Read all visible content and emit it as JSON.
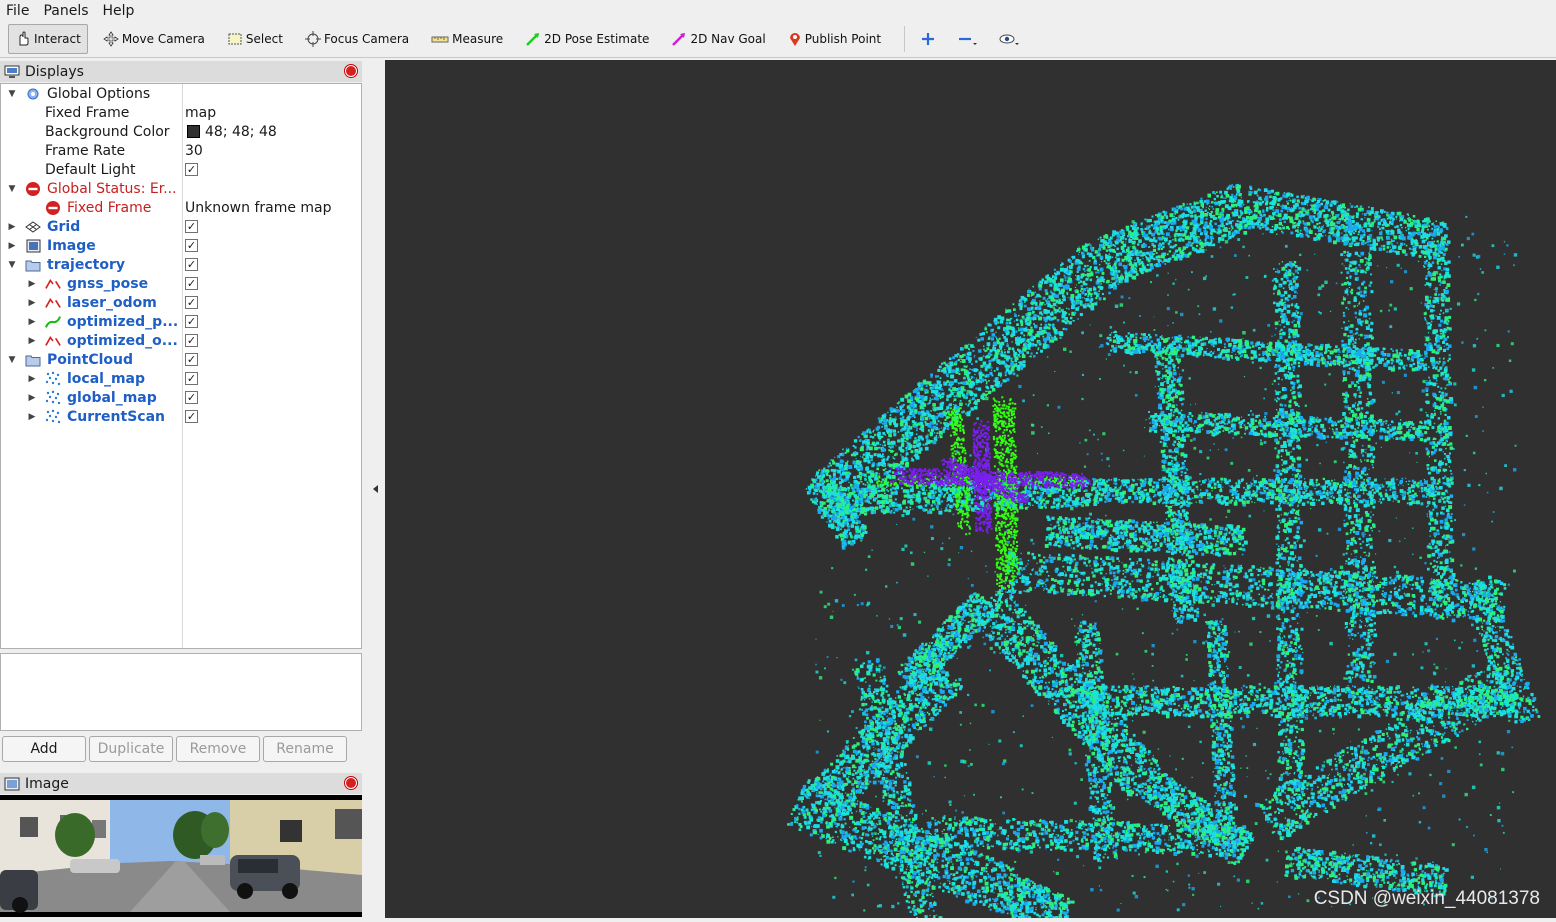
{
  "menu": [
    "File",
    "Panels",
    "Help"
  ],
  "toolbar": [
    {
      "label": "Interact",
      "icon": "interact-icon",
      "active": true
    },
    {
      "label": "Move Camera",
      "icon": "move-camera-icon"
    },
    {
      "label": "Select",
      "icon": "select-icon"
    },
    {
      "label": "Focus Camera",
      "icon": "focus-camera-icon"
    },
    {
      "label": "Measure",
      "icon": "measure-icon"
    },
    {
      "label": "2D Pose Estimate",
      "icon": "pose-estimate-icon",
      "color": "#22cc22"
    },
    {
      "label": "2D Nav Goal",
      "icon": "nav-goal-icon",
      "color": "#cc22cc"
    },
    {
      "label": "Publish Point",
      "icon": "publish-point-icon",
      "color": "#d83a1a"
    }
  ],
  "displays_panel": {
    "title": "Displays",
    "rows": [
      {
        "label": "Global Options",
        "value": "",
        "style": "normal",
        "depth": 0,
        "arrow": "down",
        "icon": "gear-icon"
      },
      {
        "label": "Fixed Frame",
        "value": "map",
        "style": "normal",
        "depth": 1
      },
      {
        "label": "Background Color",
        "value": "48; 48; 48",
        "style": "normal",
        "depth": 1,
        "swatch": "#303030"
      },
      {
        "label": "Frame Rate",
        "value": "30",
        "style": "normal",
        "depth": 1
      },
      {
        "label": "Default Light",
        "value": "",
        "style": "normal",
        "depth": 1,
        "checked": true
      },
      {
        "label": "Global Status: Er...",
        "value": "",
        "style": "red",
        "depth": 0,
        "arrow": "down",
        "icon": "error-icon"
      },
      {
        "label": "Fixed Frame",
        "value": "Unknown frame map",
        "style": "red",
        "depth": 1,
        "icon": "error-icon"
      },
      {
        "label": "Grid",
        "value": "",
        "style": "blue",
        "depth": 0,
        "arrow": "right",
        "icon": "grid-icon",
        "checked": true
      },
      {
        "label": "Image",
        "value": "",
        "style": "blue",
        "depth": 0,
        "arrow": "right",
        "icon": "image-icon",
        "checked": true
      },
      {
        "label": "trajectory",
        "value": "",
        "style": "blue",
        "depth": 0,
        "arrow": "down",
        "icon": "folder-icon",
        "checked": true
      },
      {
        "label": "gnss_pose",
        "value": "",
        "style": "blue",
        "depth": 1,
        "arrow": "right",
        "icon": "path-red-icon",
        "checked": true
      },
      {
        "label": "laser_odom",
        "value": "",
        "style": "blue",
        "depth": 1,
        "arrow": "right",
        "icon": "path-red-icon",
        "checked": true
      },
      {
        "label": "optimized_p...",
        "value": "",
        "style": "blue",
        "depth": 1,
        "arrow": "right",
        "icon": "path-green-icon",
        "checked": true
      },
      {
        "label": "optimized_o...",
        "value": "",
        "style": "blue",
        "depth": 1,
        "arrow": "right",
        "icon": "path-red-icon",
        "checked": true
      },
      {
        "label": "PointCloud",
        "value": "",
        "style": "blue",
        "depth": 0,
        "arrow": "down",
        "icon": "folder-icon",
        "checked": true
      },
      {
        "label": "local_map",
        "value": "",
        "style": "blue",
        "depth": 1,
        "arrow": "right",
        "icon": "pointcloud-icon",
        "checked": true
      },
      {
        "label": "global_map",
        "value": "",
        "style": "blue",
        "depth": 1,
        "arrow": "right",
        "icon": "pointcloud-icon",
        "checked": true
      },
      {
        "label": "CurrentScan",
        "value": "",
        "style": "blue",
        "depth": 1,
        "arrow": "right",
        "icon": "pointcloud-icon",
        "checked": true
      }
    ]
  },
  "buttons": [
    {
      "label": "Add",
      "enabled": true
    },
    {
      "label": "Duplicate",
      "enabled": false
    },
    {
      "label": "Remove",
      "enabled": false
    },
    {
      "label": "Rename",
      "enabled": false
    }
  ],
  "image_panel": {
    "title": "Image"
  },
  "watermark": "CSDN @weixin_44081378",
  "colors": {
    "viewport_bg": "#303030",
    "map_cyan": "#19e6d2",
    "map_blue": "#1aa8f0",
    "map_green": "#2bf07a",
    "trajectory_green": "#30ff10",
    "trajectory_purple": "#7a1ef0"
  }
}
